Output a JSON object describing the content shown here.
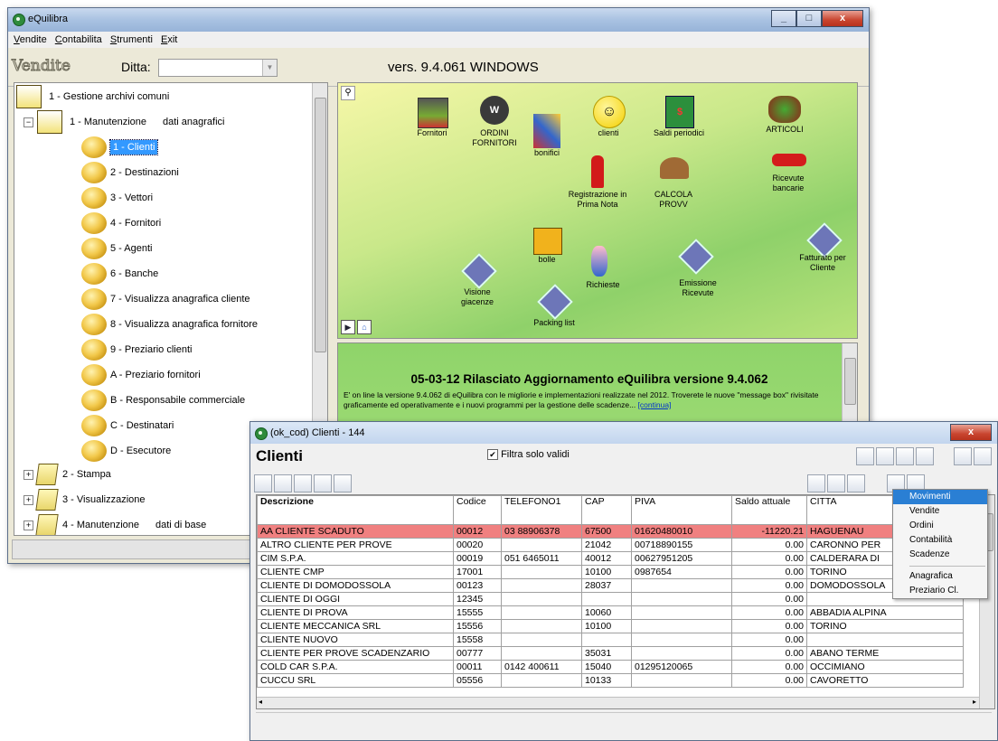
{
  "main_window": {
    "title": "eQuilibra",
    "menu": [
      "Vendite",
      "Contabilita",
      "Strumenti",
      "Exit"
    ],
    "module_label": "Vendite",
    "ditta_label": "Ditta:",
    "ditta_value": "",
    "version": "vers. 9.4.061 WINDOWS",
    "window_buttons": [
      "_",
      "□",
      "x"
    ]
  },
  "tree": {
    "root": "1 - Gestione archivi comuni",
    "group1": {
      "label": "1 - Manutenzione",
      "sublabel": "dati anagrafici"
    },
    "items": [
      "1 - Clienti",
      "2 - Destinazioni",
      "3 - Vettori",
      "4 - Fornitori",
      "5 - Agenti",
      "6 - Banche",
      "7 - Visualizza anagrafica cliente",
      "8 - Visualizza anagrafica fornitore",
      "9 - Preziario clienti",
      "A - Preziario fornitori",
      "B - Responsabile commerciale",
      "C - Destinatari",
      "D - Esecutore"
    ],
    "selected_item": "1 - Clienti",
    "other_groups": [
      {
        "label": "2 - Stampa",
        "sublabel": ""
      },
      {
        "label": "3 - Visualizzazione",
        "sublabel": ""
      },
      {
        "label": "4 - Manutenzione",
        "sublabel": "dati di base"
      }
    ]
  },
  "desktop_icons": {
    "fornitori": "Fornitori",
    "ordini": "ORDINI FORNITORI",
    "bonifici": "bonifici",
    "clienti": "clienti",
    "saldi": "Saldi periodici",
    "articoli": "ARTICOLI",
    "registrazione": "Registrazione in Prima Nota",
    "calcola": "CALCOLA PROVV",
    "ricevute": "Ricevute bancarie",
    "bolle": "bolle",
    "richieste": "Richieste",
    "emissione": "Emissione Ricevute",
    "fatturato": "Fatturato per Cliente",
    "visione": "Visione giacenze",
    "packing": "Packing list"
  },
  "news": {
    "headline": "05-03-12 Rilasciato Aggiornamento eQuilibra versione 9.4.062",
    "body": "E' on line la versione 9.4.062 di eQuilibra con le migliorie e implementazioni realizzate nel 2012. Troverete le nuove \"message box\" rivisitate graficamente ed operativamente e i nuovi programmi per la gestione delle scadenze...",
    "link": "[continua]"
  },
  "clienti_window": {
    "title": "(ok_cod) Clienti - 144",
    "heading": "Clienti",
    "filter_label": "Filtra solo validi",
    "filter_checked": true,
    "columns": [
      "Descrizione",
      "Codice",
      "TELEFONO1",
      "CAP",
      "PIVA",
      "Saldo attuale",
      "CITTA"
    ],
    "rows": [
      [
        "AA CLIENTE SCADUTO",
        "00012",
        "03 88906378",
        "67500",
        "01620480010",
        "-11220.21",
        "HAGUENAU"
      ],
      [
        "ALTRO CLIENTE PER PROVE",
        "00020",
        "",
        "21042",
        "00718890155",
        "0.00",
        "CARONNO PER"
      ],
      [
        "CIM S.P.A.",
        "00019",
        "051 6465011",
        "40012",
        "00627951205",
        "0.00",
        "CALDERARA DI"
      ],
      [
        "CLIENTE CMP",
        "17001",
        "",
        "10100",
        "0987654",
        "0.00",
        "TORINO"
      ],
      [
        "CLIENTE DI DOMODOSSOLA",
        "00123",
        "",
        "28037",
        "",
        "0.00",
        "DOMODOSSOLA"
      ],
      [
        "CLIENTE DI OGGI",
        "12345",
        "",
        "",
        "",
        "0.00",
        ""
      ],
      [
        "CLIENTE DI PROVA",
        "15555",
        "",
        "10060",
        "",
        "0.00",
        "ABBADIA ALPINA"
      ],
      [
        "CLIENTE MECCANICA SRL",
        "15556",
        "",
        "10100",
        "",
        "0.00",
        "TORINO"
      ],
      [
        "CLIENTE NUOVO",
        "15558",
        "",
        "",
        "",
        "0.00",
        ""
      ],
      [
        "CLIENTE PER PROVE SCADENZARIO",
        "00777",
        "",
        "35031",
        "",
        "0.00",
        "ABANO TERME"
      ],
      [
        "COLD CAR S.P.A.",
        "00011",
        "0142 400611",
        "15040",
        "01295120065",
        "0.00",
        "OCCIMIANO"
      ],
      [
        "CUCCU SRL",
        "05556",
        "",
        "10133",
        "",
        "0.00",
        "CAVORETTO"
      ]
    ],
    "highlight_color": "#f08080",
    "context_menu": [
      "Movimenti",
      "Vendite",
      "Ordini",
      "Contabilità",
      "Scadenze",
      "Anagrafica",
      "Preziario Cl."
    ],
    "context_selected": "Movimenti"
  }
}
